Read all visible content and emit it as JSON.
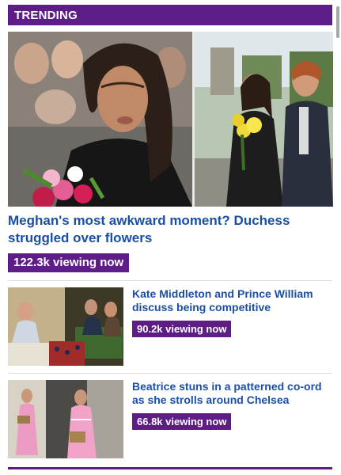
{
  "header": {
    "section_label": "TRENDING"
  },
  "hero": {
    "headline": "Meghan's most awkward moment? Duchess struggled over flowers",
    "viewers": "122.3k viewing now"
  },
  "stories": [
    {
      "title": "Kate Middleton and Prince William discuss being competitive",
      "viewers": "90.2k viewing now"
    },
    {
      "title": "Beatrice stuns in a patterned co-ord as she strolls around Chelsea",
      "viewers": "66.8k viewing now"
    }
  ],
  "colors": {
    "brand_purple": "#5e1c87",
    "headline_blue": "#1a4fa7"
  }
}
